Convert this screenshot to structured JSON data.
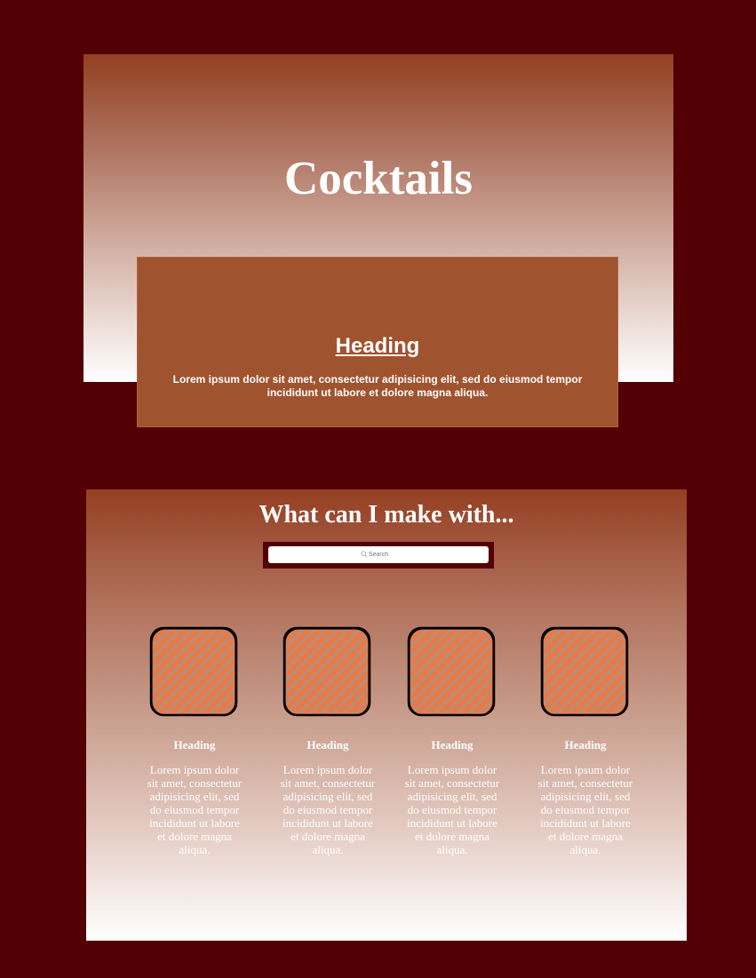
{
  "hero": {
    "title": "Cocktails"
  },
  "feature": {
    "heading": "Heading",
    "text": "Lorem ipsum dolor sit amet, consectetur adipisicing elit, sed do eiusmod tempor incididunt ut labore et dolore magna aliqua."
  },
  "finder": {
    "title": "What can I make with...",
    "search": {
      "placeholder": "Search",
      "icon": "search-icon"
    },
    "items": [
      {
        "icon": "image-placeholder-icon",
        "heading": "Heading",
        "text": "Lorem ipsum dolor sit amet, consectetur adipisicing elit, sed do eiusmod tempor incididunt ut labore et dolore magna aliqua."
      },
      {
        "icon": "image-placeholder-icon",
        "heading": "Heading",
        "text": "Lorem ipsum dolor sit amet, consectetur adipisicing elit, sed do eiusmod tempor incididunt ut labore et dolore magna aliqua."
      },
      {
        "icon": "image-placeholder-icon",
        "heading": "Heading",
        "text": "Lorem ipsum dolor sit amet, consectetur adipisicing elit, sed do eiusmod tempor incididunt ut labore et dolore magna aliqua."
      },
      {
        "icon": "image-placeholder-icon",
        "heading": "Heading",
        "text": "Lorem ipsum dolor sit amet, consectetur adipisicing elit, sed do eiusmod tempor incididunt ut labore et dolore magna aliqua."
      }
    ]
  },
  "colors": {
    "page_background": "#520004",
    "accent": "#943f22",
    "card": "#a0532f",
    "placeholder_fill": "#e87a45"
  }
}
